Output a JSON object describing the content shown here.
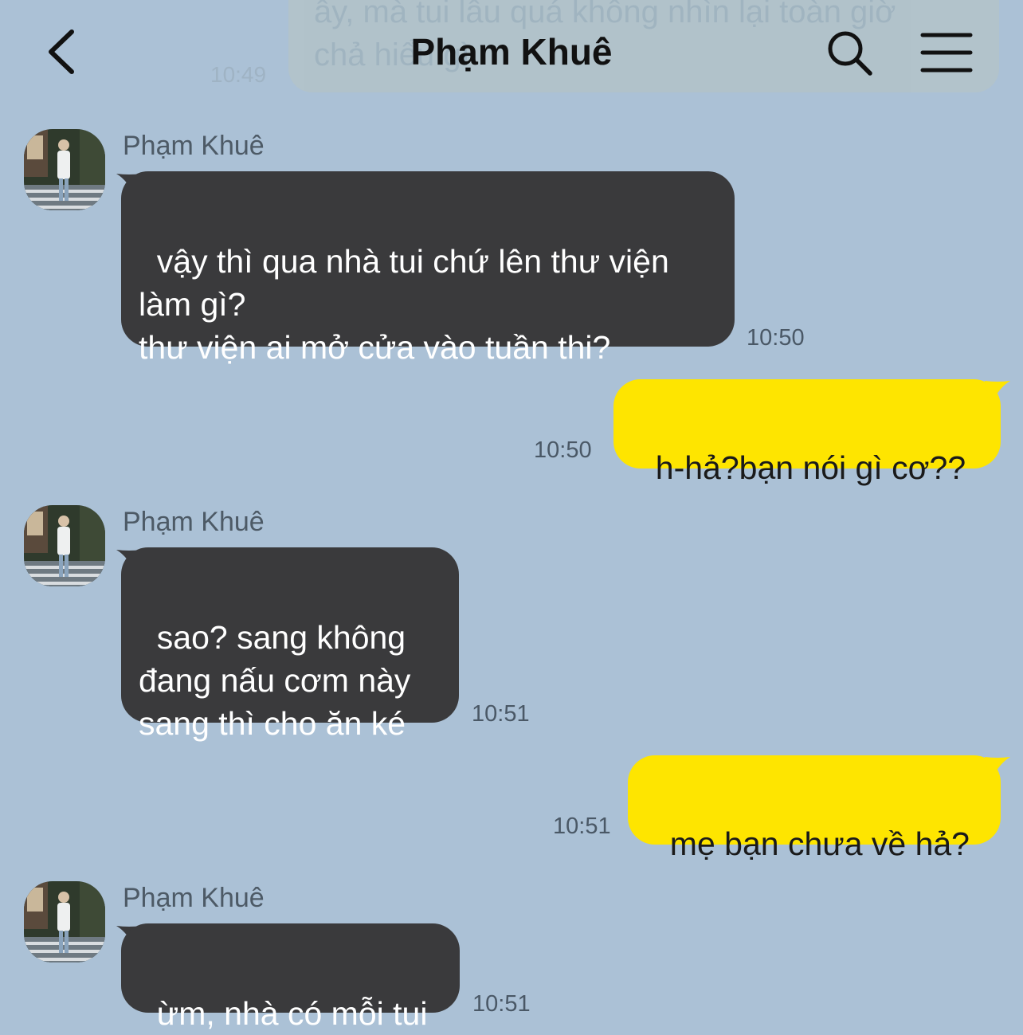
{
  "header": {
    "title": "Phạm Khuê"
  },
  "previous_message": {
    "text": "ây, mà tui lâu quá không nhìn lại toàn giờ\nchả hiểu gì",
    "time": "10:49"
  },
  "messages": [
    {
      "sender": "Phạm Khuê",
      "direction": "incoming",
      "text": "vậy thì qua nhà tui chứ lên thư viện\nlàm gì?\nthư viện ai mở cửa vào tuần thi?",
      "time": "10:50"
    },
    {
      "direction": "outgoing",
      "text": "h-hả?bạn nói gì cơ??",
      "time": "10:50"
    },
    {
      "sender": "Phạm Khuê",
      "direction": "incoming",
      "text": "sao? sang không\nđang nấu cơm này\nsang thì cho ăn ké",
      "time": "10:51"
    },
    {
      "direction": "outgoing",
      "text": "mẹ bạn chưa về hả?",
      "time": "10:51"
    },
    {
      "sender": "Phạm Khuê",
      "direction": "incoming",
      "text": "ừm, nhà có mỗi tui",
      "time": "10:51"
    }
  ],
  "colors": {
    "background": "#abc1d6",
    "incoming_bubble": "#3a3a3c",
    "outgoing_bubble": "#fee500"
  },
  "icons": {
    "back": "chevron-left-icon",
    "search": "search-icon",
    "menu": "hamburger-menu-icon"
  }
}
